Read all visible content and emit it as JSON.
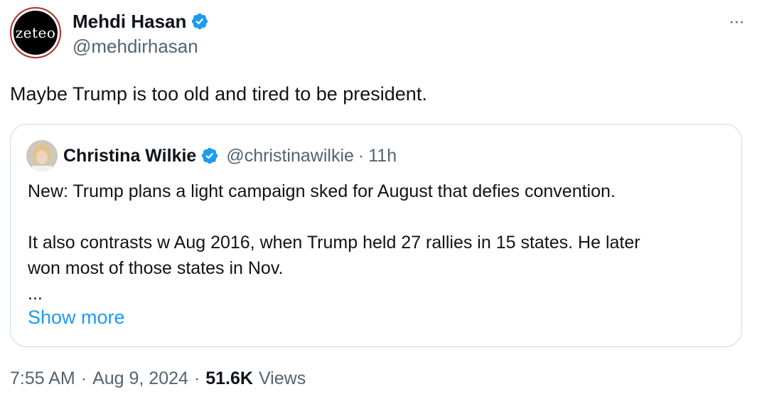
{
  "author": {
    "display_name": "Mehdi Hasan",
    "handle": "@mehdirhasan",
    "avatar_text": "zeteo",
    "verified": true
  },
  "tweet_text": "Maybe Trump is too old and tired to be president.",
  "more_icon": "⋯",
  "quoted_tweet": {
    "display_name": "Christina Wilkie",
    "handle": "@christinawilkie",
    "separator": "·",
    "time": "11h",
    "verified": true,
    "paragraph_1": "New: Trump plans a light campaign sked for August that defies convention.",
    "paragraph_2a": "It also contrasts w Aug 2016, when Trump held 27 rallies in 15 states. He later",
    "paragraph_2b": "won most of those states in Nov.",
    "ellipsis": "...",
    "show_more": "Show more"
  },
  "meta": {
    "time": "7:55 AM",
    "sep1": "·",
    "date": "Aug 9, 2024",
    "sep2": "·",
    "views_count": "51.6K",
    "views_label": "Views"
  },
  "colors": {
    "verified": "#1d9bf0",
    "link": "#1d9bf0",
    "secondary_text": "#536471",
    "avatar_ring": "#b32d2d"
  },
  "icons": {
    "verified": "verified-badge-icon",
    "more": "more-options-icon"
  }
}
